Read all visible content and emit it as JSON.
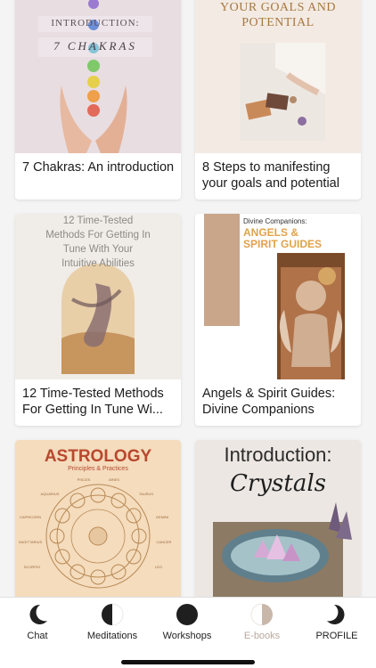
{
  "books": [
    {
      "cover_lines": [
        "INTRODUCTION:",
        "7 CHAKRAS"
      ],
      "caption": "7 Chakras: An introduction"
    },
    {
      "cover_lines": [
        "YOUR GOALS AND",
        "POTENTIAL"
      ],
      "caption": "8 Steps to manifesting your goals and potential"
    },
    {
      "cover_lines": [
        "12 Time-Tested",
        "Methods For Getting In",
        "Tune With Your",
        "Intuitive Abilities"
      ],
      "caption": "12 Time-Tested Methods For Getting In Tune Wi..."
    },
    {
      "cover_lines": [
        "Divine Companions:",
        "ANGELS &",
        "SPIRIT GUIDES"
      ],
      "caption": "Angels & Spirit Guides: Divine Companions"
    },
    {
      "cover_lines": [
        "ASTROLOGY",
        "Principles & Practices"
      ],
      "zodiac_labels": [
        "PISCES",
        "ARIES",
        "TAURUS",
        "GEMINI",
        "CANCER",
        "LEO",
        "SCORPIO",
        "SAGITTARIUS",
        "CAPRICORN",
        "AQUARIUS"
      ],
      "caption": ""
    },
    {
      "cover_lines": [
        "Introduction:",
        "Crystals"
      ],
      "caption": ""
    }
  ],
  "tabs": [
    {
      "label": "Chat",
      "icon": "crescent-moon-icon",
      "active": false
    },
    {
      "label": "Meditations",
      "icon": "half-moon-icon",
      "active": false
    },
    {
      "label": "Workshops",
      "icon": "full-moon-icon",
      "active": false
    },
    {
      "label": "E-books",
      "icon": "half-moon-active-icon",
      "active": true
    },
    {
      "label": "PROFILE",
      "icon": "crescent-moon-right-icon",
      "active": false
    }
  ],
  "colors": {
    "accent_active": "#b8a89c",
    "text": "#1b1b1b",
    "astrology_red": "#b8482e",
    "angels_gold": "#e0a24a"
  }
}
